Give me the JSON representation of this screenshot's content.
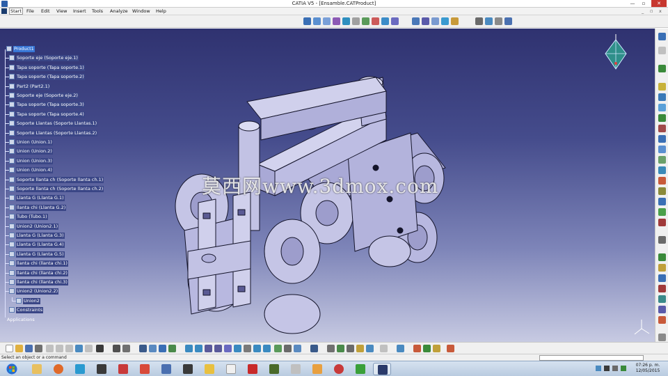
{
  "window": {
    "title": "CATIA V5 - [Ensamble.CATProduct]",
    "minimize_label": "—",
    "maximize_label": "▫",
    "close_label": "✕"
  },
  "menu": {
    "items": [
      "Start",
      "File",
      "Edit",
      "View",
      "Insert",
      "Tools",
      "Analyze",
      "Window",
      "Help"
    ]
  },
  "tree": {
    "nodes": [
      "Product1",
      "Soporte eje (Soporte eje.1)",
      "Tapa soporte (Tapa soporte.1)",
      "Tapa soporte (Tapa soporte.2)",
      "Part2 (Part2.1)",
      "Soporte eje (Soporte eje.2)",
      "Tapa soporte (Tapa soporte.3)",
      "Tapa soporte (Tapa soporte.4)",
      "Soporte Llantas (Soporte Llantas.1)",
      "Soporte Llantas (Soporte Llantas.2)",
      "Union (Union.1)",
      "Union (Union.2)",
      "Union (Union.3)",
      "Union (Union.4)",
      "Soporte llanta ch (Soporte llanta ch.1)",
      "Soporte llanta ch (Soporte llanta ch.2)",
      "Llanta G (Llanta G.1)",
      "llanta chi (Llanta G.2)",
      "Tubo (Tubo.1)",
      "Union2 (Union2.1)",
      "Llanta G (Llanta G.3)",
      "Llanta G (Llanta G.4)",
      "Llanta G (Llanta G.5)",
      "llanta chi (llanta chi.1)",
      "llanta chi (llanta chi.2)",
      "llanta chi (llanta chi.3)",
      "Union2 (Union2.2)",
      "Union2",
      "Constraints",
      "Applications"
    ]
  },
  "watermark": "莫西网www.3dmox.com",
  "status": {
    "message": "Select an object or a command",
    "command_input": ""
  },
  "clock": {
    "time": "07:26 p. m.",
    "date": "12/05/2015"
  },
  "colors": {
    "viewport_top": "#2f3270",
    "viewport_bottom": "#c7cae2",
    "part_fill": "#c5c5e6",
    "part_shade": "#9d9dcc",
    "tree_selection": "#3876d6"
  }
}
